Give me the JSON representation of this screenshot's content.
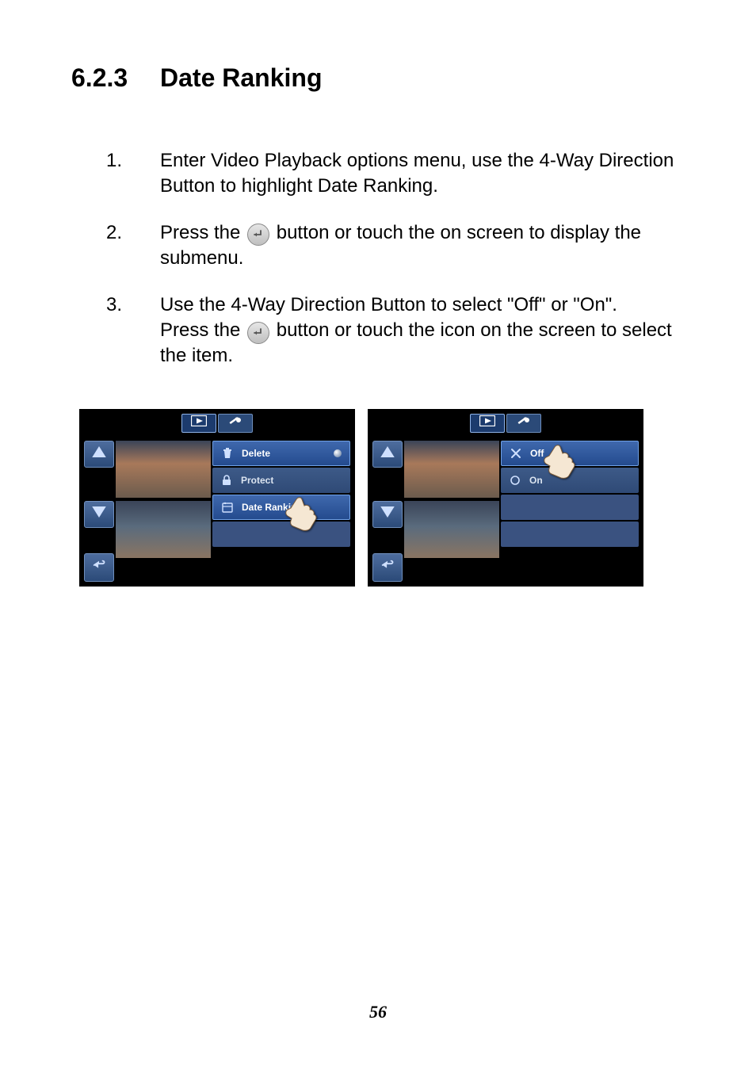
{
  "heading": {
    "number": "6.2.3",
    "title": "Date Ranking"
  },
  "steps": {
    "s1": {
      "num": "1.",
      "text": "Enter Video Playback options menu, use the 4-Way Direction Button to highlight Date Ranking."
    },
    "s2": {
      "num": "2.",
      "pre": "Press the ",
      "post": " button or touch the on screen to display the submenu."
    },
    "s3": {
      "num": "3.",
      "line1": "Use the 4-Way Direction Button to select \"Off\" or \"On\".",
      "pre": "Press the ",
      "post": " button or touch the icon on the screen to select the item."
    }
  },
  "screens": {
    "left": {
      "menu": {
        "delete": "Delete",
        "protect": "Protect",
        "dateRanking": "Date Ranking"
      },
      "selectedIndex": 2
    },
    "right": {
      "menu": {
        "off": "Off",
        "on": "On"
      },
      "selectedIndex": 0
    }
  },
  "pageNumber": "56",
  "icons": {
    "enter": "enter-icon",
    "play": "play-icon",
    "wrench": "wrench-icon",
    "up": "triangle-up-icon",
    "down": "triangle-down-icon",
    "back": "return-icon",
    "trash": "trash-icon",
    "lock": "lock-icon",
    "calendar": "calendar-icon",
    "x": "x-icon",
    "circle": "circle-icon",
    "hand": "hand-pointer-icon"
  }
}
